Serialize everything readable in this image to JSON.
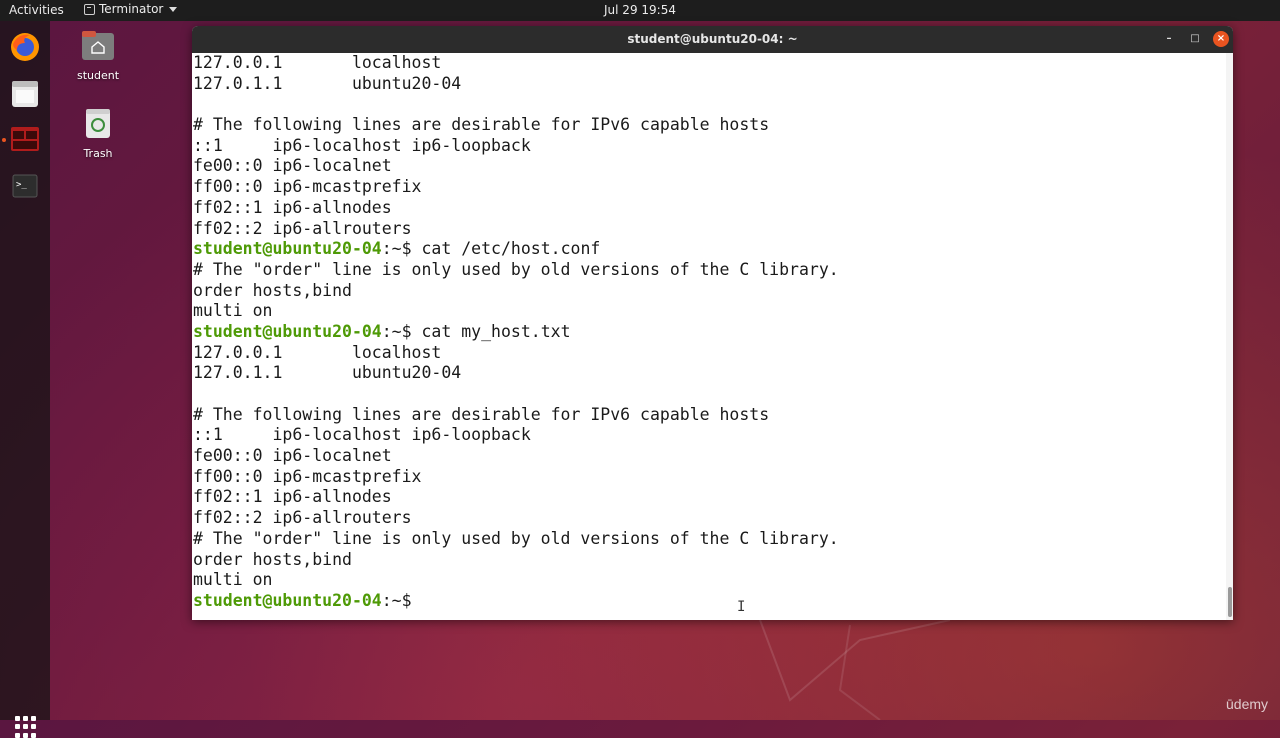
{
  "topbar": {
    "activities": "Activities",
    "app_name": "Terminator",
    "clock": "Jul 29  19:54"
  },
  "desktop": {
    "home_label": "student",
    "trash_label": "Trash"
  },
  "dock": {
    "items": [
      "firefox-icon",
      "files-icon",
      "terminator-icon",
      "terminal-icon"
    ]
  },
  "window": {
    "title": "student@ubuntu20-04: ~",
    "buttons": {
      "minimize": "–",
      "maximize": "□",
      "close": "×"
    }
  },
  "terminal": {
    "prompt_user": "student@ubuntu20-04",
    "prompt_sep": ":~$",
    "lines": [
      {
        "text": "127.0.0.1       localhost"
      },
      {
        "text": "127.0.1.1       ubuntu20-04"
      },
      {
        "text": ""
      },
      {
        "text": "# The following lines are desirable for IPv6 capable hosts"
      },
      {
        "text": "::1     ip6-localhost ip6-loopback"
      },
      {
        "text": "fe00::0 ip6-localnet"
      },
      {
        "text": "ff00::0 ip6-mcastprefix"
      },
      {
        "text": "ff02::1 ip6-allnodes"
      },
      {
        "text": "ff02::2 ip6-allrouters"
      },
      {
        "prompt": true,
        "cmd": " cat /etc/host.conf"
      },
      {
        "text": "# The \"order\" line is only used by old versions of the C library."
      },
      {
        "text": "order hosts,bind"
      },
      {
        "text": "multi on"
      },
      {
        "prompt": true,
        "cmd": " cat my_host.txt"
      },
      {
        "text": "127.0.0.1       localhost"
      },
      {
        "text": "127.0.1.1       ubuntu20-04"
      },
      {
        "text": ""
      },
      {
        "text": "# The following lines are desirable for IPv6 capable hosts"
      },
      {
        "text": "::1     ip6-localhost ip6-loopback"
      },
      {
        "text": "fe00::0 ip6-localnet"
      },
      {
        "text": "ff00::0 ip6-mcastprefix"
      },
      {
        "text": "ff02::1 ip6-allnodes"
      },
      {
        "text": "ff02::2 ip6-allrouters"
      },
      {
        "text": "# The \"order\" line is only used by old versions of the C library."
      },
      {
        "text": "order hosts,bind"
      },
      {
        "text": "multi on"
      },
      {
        "prompt": true,
        "cmd": " "
      }
    ]
  },
  "watermark": "ūdemy",
  "colors": {
    "accent": "#e95420",
    "prompt_green": "#4e9a06",
    "titlebar": "#2c2c2c"
  }
}
